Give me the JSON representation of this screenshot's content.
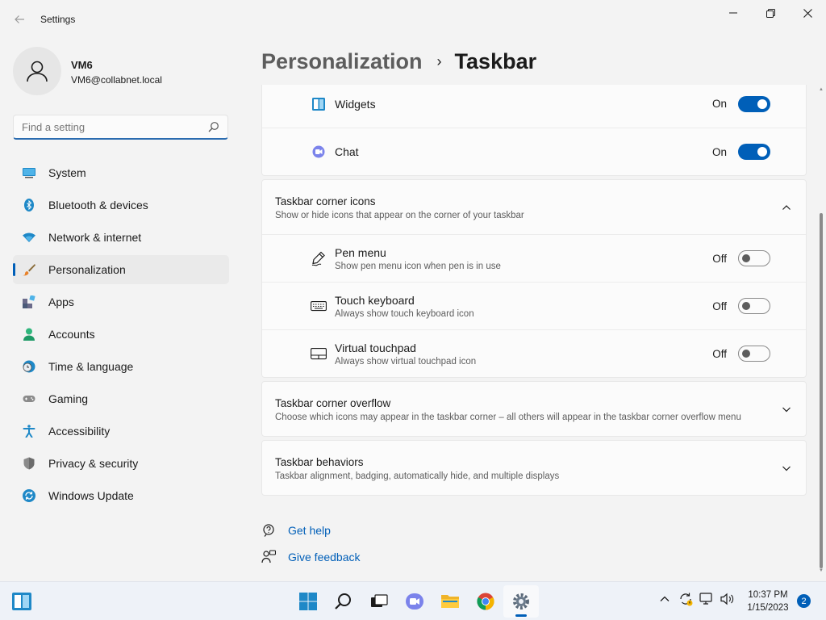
{
  "window": {
    "title": "Settings",
    "back_icon": "back-arrow-icon",
    "controls": [
      "minimize-icon",
      "restore-icon",
      "close-icon"
    ]
  },
  "user": {
    "name": "VM6",
    "email": "VM6@collabnet.local"
  },
  "search": {
    "placeholder": "Find a setting"
  },
  "nav": {
    "items": [
      {
        "label": "System",
        "icon": "system-icon"
      },
      {
        "label": "Bluetooth & devices",
        "icon": "bluetooth-icon"
      },
      {
        "label": "Network & internet",
        "icon": "wifi-icon"
      },
      {
        "label": "Personalization",
        "icon": "brush-icon",
        "active": true
      },
      {
        "label": "Apps",
        "icon": "apps-icon"
      },
      {
        "label": "Accounts",
        "icon": "accounts-icon"
      },
      {
        "label": "Time & language",
        "icon": "clock-globe-icon"
      },
      {
        "label": "Gaming",
        "icon": "gamepad-icon"
      },
      {
        "label": "Accessibility",
        "icon": "accessibility-icon"
      },
      {
        "label": "Privacy & security",
        "icon": "shield-icon"
      },
      {
        "label": "Windows Update",
        "icon": "update-icon"
      }
    ]
  },
  "breadcrumb": {
    "parent": "Personalization",
    "separator": "›",
    "current": "Taskbar"
  },
  "taskbar_items": {
    "rows": [
      {
        "label": "Widgets",
        "state": "On",
        "on": true,
        "icon": "widgets-icon"
      },
      {
        "label": "Chat",
        "state": "On",
        "on": true,
        "icon": "chat-icon"
      }
    ]
  },
  "corner_icons": {
    "title": "Taskbar corner icons",
    "subtitle": "Show or hide icons that appear on the corner of your taskbar",
    "expanded": true,
    "rows": [
      {
        "label": "Pen menu",
        "sub": "Show pen menu icon when pen is in use",
        "state": "Off",
        "on": false,
        "icon": "pen-icon"
      },
      {
        "label": "Touch keyboard",
        "sub": "Always show touch keyboard icon",
        "state": "Off",
        "on": false,
        "icon": "keyboard-icon"
      },
      {
        "label": "Virtual touchpad",
        "sub": "Always show virtual touchpad icon",
        "state": "Off",
        "on": false,
        "icon": "touchpad-icon"
      }
    ]
  },
  "corner_overflow": {
    "title": "Taskbar corner overflow",
    "subtitle": "Choose which icons may appear in the taskbar corner – all others will appear in the taskbar corner overflow menu"
  },
  "behaviors": {
    "title": "Taskbar behaviors",
    "subtitle": "Taskbar alignment, badging, automatically hide, and multiple displays"
  },
  "help_links": {
    "get_help": "Get help",
    "give_feedback": "Give feedback"
  },
  "taskbar": {
    "apps": [
      "start-icon",
      "search-icon",
      "task-view-icon",
      "teams-chat-icon",
      "file-explorer-icon",
      "chrome-icon",
      "settings-gear-icon"
    ],
    "active_app": "settings-gear-icon",
    "tray": [
      "chevron-up-icon",
      "sync-icon",
      "network-icon",
      "volume-icon"
    ],
    "time": "10:37 PM",
    "date": "1/15/2023",
    "notifications": "2"
  },
  "colors": {
    "accent": "#005fb8",
    "window_bg": "#f3f3f3",
    "card_bg": "#fbfbfb",
    "taskbar_bg": "#eef2f8"
  }
}
